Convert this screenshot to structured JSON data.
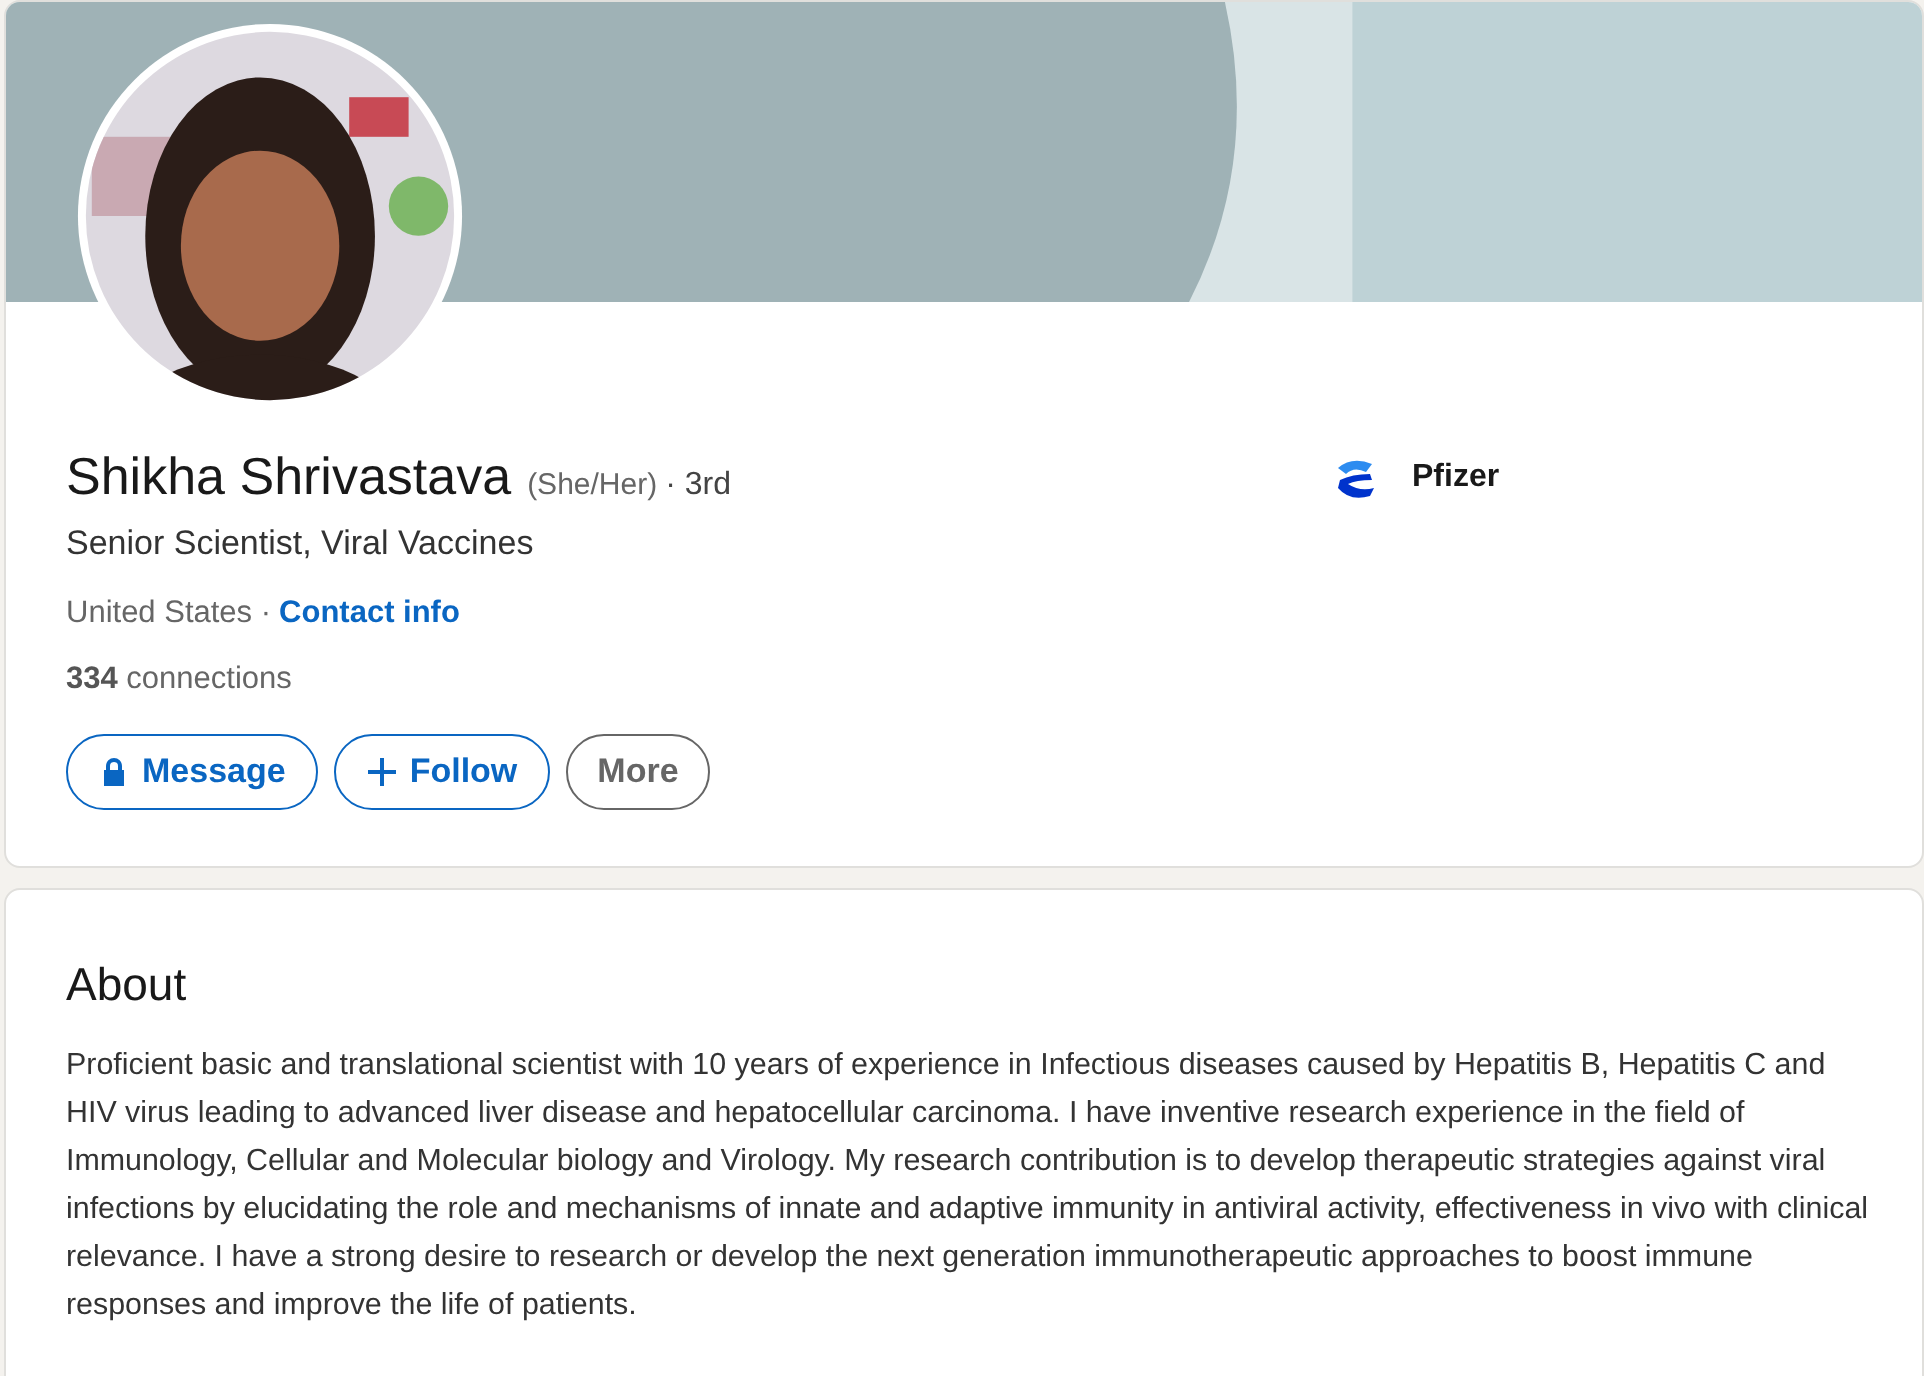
{
  "profile": {
    "name": "Shikha Shrivastava",
    "pronouns": "(She/Her)",
    "degree": "· 3rd",
    "headline": "Senior Scientist, Viral Vaccines",
    "location": "United States ·",
    "contact_link": "Contact info",
    "connections_count": "334",
    "connections_label": "connections",
    "buttons": [
      {
        "label": "Message",
        "kind": "message"
      },
      {
        "label": "Follow",
        "kind": "follow"
      },
      {
        "label": "More",
        "kind": "more"
      }
    ],
    "company": "Pfizer"
  },
  "about": {
    "heading": "About",
    "text": "Proficient basic and translational scientist with 10 years of experience in Infectious diseases caused by Hepatitis B, Hepatitis C and HIV virus leading to advanced liver disease and hepatocellular carcinoma. I have inventive research experience in the field of Immunology, Cellular and Molecular biology and Virology. My research contribution is to develop therapeutic strategies against viral infections by elucidating the role and mechanisms of innate and adaptive immunity in antiviral activity, effectiveness in vivo with clinical relevance. I have a strong desire to research or develop the next generation immunotherapeutic approaches to boost immune responses and improve the life of patients."
  }
}
